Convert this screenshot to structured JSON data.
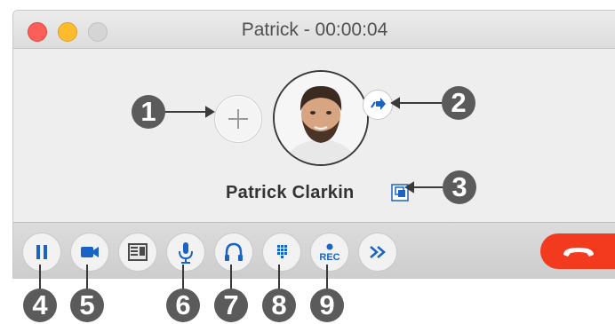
{
  "window": {
    "title": "Patrick - 00:00:04"
  },
  "call": {
    "contact_name": "Patrick Clarkin"
  },
  "controls": [
    {
      "name": "pause-button",
      "icon": "pause-icon"
    },
    {
      "name": "video-button",
      "icon": "video-camera-icon"
    },
    {
      "name": "contact-card-button",
      "icon": "contact-card-icon"
    },
    {
      "name": "mute-button",
      "icon": "microphone-icon"
    },
    {
      "name": "audio-device-button",
      "icon": "headset-icon"
    },
    {
      "name": "keypad-button",
      "icon": "dialpad-icon"
    },
    {
      "name": "record-button",
      "icon": "record-icon",
      "label": "REC"
    },
    {
      "name": "forward-button",
      "icon": "double-arrow-icon"
    },
    {
      "name": "hangup-button",
      "icon": "phone-hangup-icon"
    }
  ],
  "callouts": [
    "1",
    "2",
    "3",
    "4",
    "5",
    "6",
    "7",
    "8",
    "9"
  ],
  "colors": {
    "accent": "#1a63c5",
    "hangup": "#f23a1e",
    "callout": "#5b5b5b"
  }
}
